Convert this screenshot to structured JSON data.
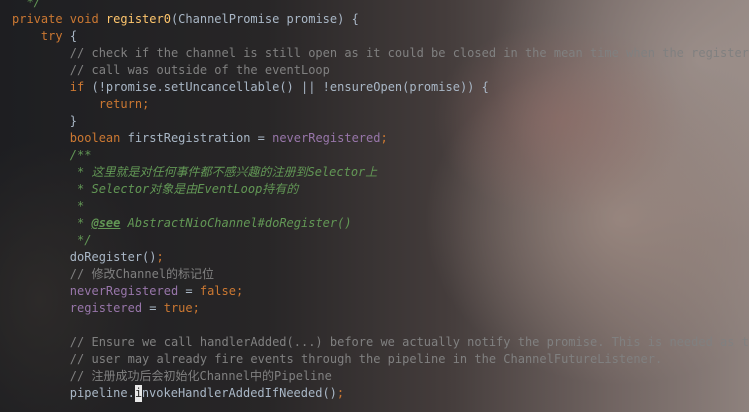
{
  "lines": [
    {
      "indent": "  ",
      "tokens": [
        {
          "t": "*/",
          "c": "doc"
        }
      ]
    },
    {
      "indent": "",
      "tokens": [
        {
          "t": "private ",
          "c": "kw"
        },
        {
          "t": "void ",
          "c": "kw"
        },
        {
          "t": "register0",
          "c": "fn"
        },
        {
          "t": "(ChannelPromise promise) {",
          "c": "plain"
        }
      ]
    },
    {
      "indent": "    ",
      "tokens": [
        {
          "t": "try ",
          "c": "kw"
        },
        {
          "t": "{",
          "c": "plain"
        }
      ]
    },
    {
      "indent": "        ",
      "tokens": [
        {
          "t": "// check if the channel is still open as it could be closed in the mean time when the register",
          "c": "cm"
        }
      ]
    },
    {
      "indent": "        ",
      "tokens": [
        {
          "t": "// call was outside of the eventLoop",
          "c": "cm"
        }
      ]
    },
    {
      "indent": "        ",
      "tokens": [
        {
          "t": "if ",
          "c": "kw"
        },
        {
          "t": "(!promise.setUncancellable() || !ensureOpen(promise)) {",
          "c": "plain"
        }
      ]
    },
    {
      "indent": "            ",
      "tokens": [
        {
          "t": "return",
          "c": "kw"
        },
        {
          "t": ";",
          "c": "kw"
        }
      ]
    },
    {
      "indent": "        ",
      "tokens": [
        {
          "t": "}",
          "c": "plain"
        }
      ]
    },
    {
      "indent": "        ",
      "tokens": [
        {
          "t": "boolean ",
          "c": "kw"
        },
        {
          "t": "firstRegistration = ",
          "c": "plain"
        },
        {
          "t": "neverRegistered",
          "c": "field"
        },
        {
          "t": ";",
          "c": "kw"
        }
      ]
    },
    {
      "indent": "        ",
      "tokens": [
        {
          "t": "/**",
          "c": "doc"
        }
      ]
    },
    {
      "indent": "         ",
      "tokens": [
        {
          "t": "* 这里就是对任何事件都不感兴趣的注册到Selector上",
          "c": "doc"
        }
      ]
    },
    {
      "indent": "         ",
      "tokens": [
        {
          "t": "* Selector对象是由EventLoop持有的",
          "c": "doc"
        }
      ]
    },
    {
      "indent": "         ",
      "tokens": [
        {
          "t": "*",
          "c": "doc"
        }
      ]
    },
    {
      "indent": "         ",
      "tokens": [
        {
          "t": "* ",
          "c": "doc"
        },
        {
          "t": "@see",
          "c": "doctag"
        },
        {
          "t": " AbstractNioChannel#doRegister()",
          "c": "docref"
        }
      ]
    },
    {
      "indent": "         ",
      "tokens": [
        {
          "t": "*/",
          "c": "doc"
        }
      ]
    },
    {
      "indent": "        ",
      "tokens": [
        {
          "t": "doRegister()",
          "c": "plain"
        },
        {
          "t": ";",
          "c": "kw"
        }
      ]
    },
    {
      "indent": "        ",
      "tokens": [
        {
          "t": "// 修改Channel的标记位",
          "c": "cm"
        }
      ]
    },
    {
      "indent": "        ",
      "tokens": [
        {
          "t": "neverRegistered",
          "c": "field"
        },
        {
          "t": " = ",
          "c": "plain"
        },
        {
          "t": "false",
          "c": "kw"
        },
        {
          "t": ";",
          "c": "kw"
        }
      ]
    },
    {
      "indent": "        ",
      "tokens": [
        {
          "t": "registered",
          "c": "field"
        },
        {
          "t": " = ",
          "c": "plain"
        },
        {
          "t": "true",
          "c": "kw"
        },
        {
          "t": ";",
          "c": "kw"
        }
      ]
    },
    {
      "indent": "",
      "tokens": []
    },
    {
      "indent": "        ",
      "tokens": [
        {
          "t": "// Ensure we call handlerAdded(...) before we actually notify the promise. This is needed as the",
          "c": "cm"
        }
      ]
    },
    {
      "indent": "        ",
      "tokens": [
        {
          "t": "// user may already fire events through the pipeline in the ChannelFutureListener.",
          "c": "cm"
        }
      ]
    },
    {
      "indent": "        ",
      "tokens": [
        {
          "t": "// 注册成功后会初始化Channel中的Pipeline",
          "c": "cm"
        }
      ]
    },
    {
      "indent": "        ",
      "tokens": [
        {
          "t": "pipeline.",
          "c": "plain"
        },
        {
          "t": "i",
          "c": "caret"
        },
        {
          "t": "nvokeHandlerAddedIfNeeded()",
          "c": "plain"
        },
        {
          "t": ";",
          "c": "kw"
        }
      ]
    }
  ]
}
